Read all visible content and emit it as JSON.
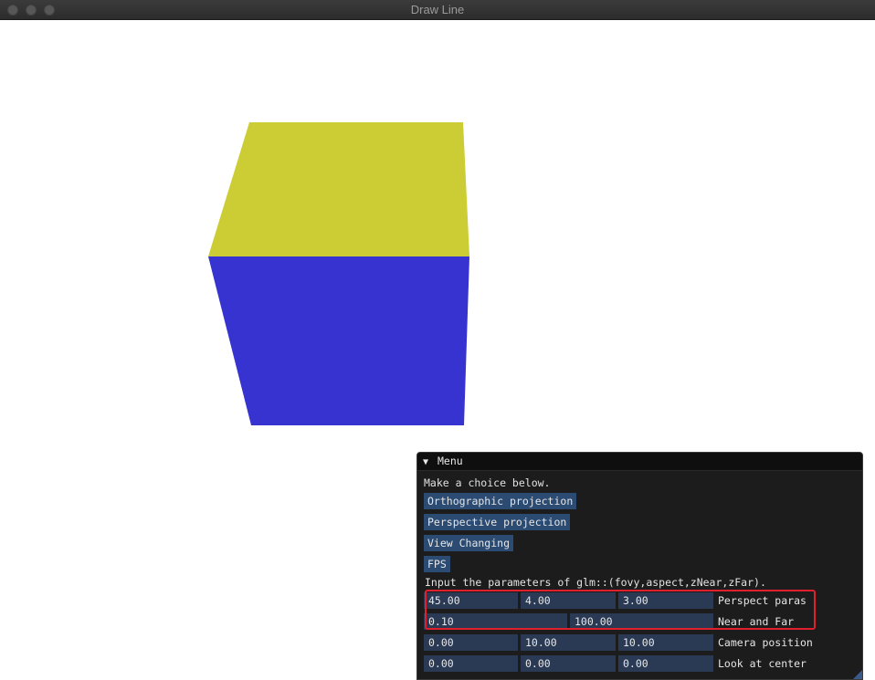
{
  "window": {
    "title": "Draw Line"
  },
  "cube": {
    "top_color": "#cccd34",
    "front_color": "#3633d1"
  },
  "panel": {
    "title": "Menu",
    "intro": "Make a choice below.",
    "buttons": [
      "Orthographic projection",
      "Perspective projection",
      "View Changing",
      "FPS"
    ],
    "prompt": "Input the parameters of glm::(fovy,aspect,zNear,zFar).",
    "perspect": {
      "values": [
        "45.00",
        "4.00",
        "3.00"
      ],
      "label": "Perspect paras"
    },
    "nearfar": {
      "values": [
        "0.10",
        "100.00"
      ],
      "label": "Near and Far"
    },
    "camera": {
      "values": [
        "0.00",
        "10.00",
        "10.00"
      ],
      "label": "Camera position"
    },
    "lookat": {
      "values": [
        "0.00",
        "0.00",
        "0.00"
      ],
      "label": "Look at center"
    }
  },
  "colors": {
    "highlight": "#e0202c",
    "button_bg": "#2b4b73",
    "field_bg": "#2a3a55"
  }
}
